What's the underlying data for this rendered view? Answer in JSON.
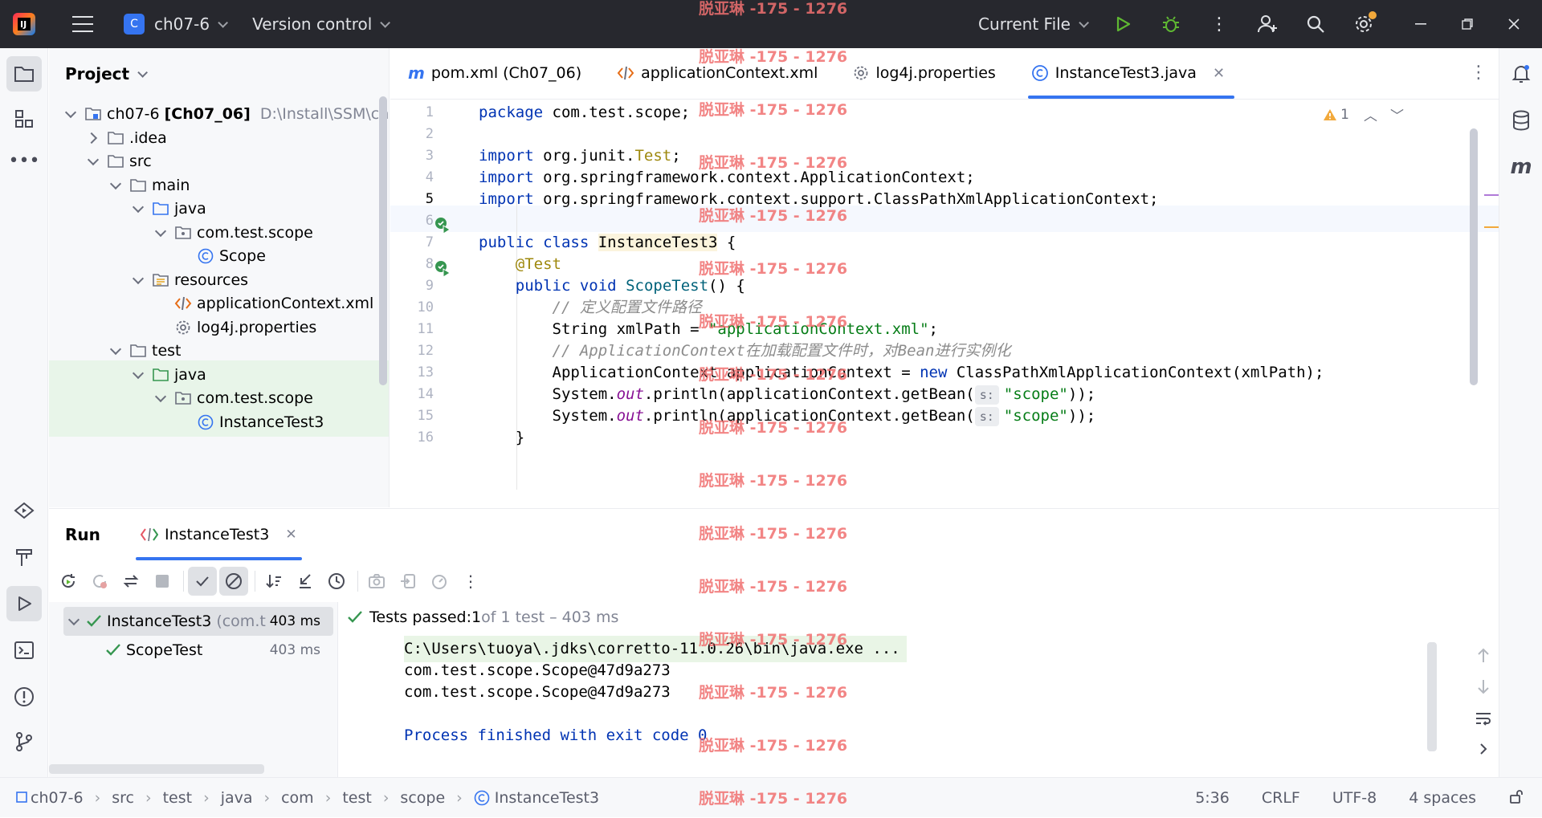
{
  "titlebar": {
    "project_badge": "C",
    "project_name": "ch07-6",
    "vcs": "Version control",
    "run_config": "Current File"
  },
  "project_panel": {
    "title": "Project",
    "tree": [
      {
        "label": "ch07-6",
        "module": "[Ch07_06]",
        "path": "D:\\Install\\SSM\\ch",
        "icon": "module-folder-icon"
      },
      {
        "label": ".idea",
        "icon": "folder-icon"
      },
      {
        "label": "src",
        "icon": "folder-icon"
      },
      {
        "label": "main",
        "icon": "folder-icon"
      },
      {
        "label": "java",
        "icon": "source-folder-icon"
      },
      {
        "label": "com.test.scope",
        "icon": "package-icon"
      },
      {
        "label": "Scope",
        "icon": "class-icon"
      },
      {
        "label": "resources",
        "icon": "resources-folder-icon"
      },
      {
        "label": "applicationContext.xml",
        "icon": "xml-file-icon"
      },
      {
        "label": "log4j.properties",
        "icon": "properties-file-icon"
      },
      {
        "label": "test",
        "icon": "folder-icon"
      },
      {
        "label": "java",
        "icon": "test-source-folder-icon"
      },
      {
        "label": "com.test.scope",
        "icon": "package-icon"
      },
      {
        "label": "InstanceTest3",
        "icon": "class-icon"
      }
    ]
  },
  "editor": {
    "tabs": [
      {
        "label": "pom.xml (Ch07_06)",
        "icon": "maven-icon"
      },
      {
        "label": "applicationContext.xml",
        "icon": "xml-file-icon"
      },
      {
        "label": "log4j.properties",
        "icon": "properties-file-icon"
      },
      {
        "label": "InstanceTest3.java",
        "icon": "class-icon",
        "active": true
      }
    ],
    "warnings": "1",
    "line_numbers": [
      "1",
      "2",
      "3",
      "4",
      "5",
      "6",
      "7",
      "8",
      "9",
      "10",
      "11",
      "12",
      "13",
      "14",
      "15",
      "16"
    ],
    "code": {
      "l1_kw": "package",
      "l1_rest": " com.test.scope;",
      "l3_kw": "import",
      "l3_a": " org.junit.",
      "l3_b": "Test",
      "l3_c": ";",
      "l4_kw": "import",
      "l4_rest": " org.springframework.context.ApplicationContext;",
      "l5_kw": "import",
      "l5_rest": " org.springframework.context.support.ClassPathXmlApplicationContext;",
      "l7_kw": "public class",
      "l7_cls": "InstanceTest3",
      "l7_rest": " {",
      "l8_ann": "@Test",
      "l9_kw": "public void",
      "l9_m": "ScopeTest",
      "l9_rest": "() {",
      "l10_cmt": "// 定义配置文件路径",
      "l11_a": "String xmlPath = ",
      "l11_str": "\"applicationContext.xml\"",
      "l11_b": ";",
      "l12_cmt": "// ApplicationContext在加载配置文件时，对Bean进行实例化",
      "l13_a": "ApplicationContext applicationContext = ",
      "l13_kw": "new",
      "l13_b": " ClassPathXmlApplicationContext(xmlPath);",
      "l14_a": "System.",
      "l14_fld": "out",
      "l14_b": ".println(applicationContext.getBean(",
      "l14_hint": "s:",
      "l14_str": "\"scope\"",
      "l14_c": "));",
      "l15_a": "System.",
      "l15_fld": "out",
      "l15_b": ".println(applicationContext.getBean(",
      "l15_hint": "s:",
      "l15_str": "\"scope\"",
      "l15_c": "));",
      "l16": "}"
    }
  },
  "run_panel": {
    "title": "Run",
    "tab_label": "InstanceTest3",
    "tests": [
      {
        "label": "InstanceTest3",
        "suffix": "(com.t",
        "time": "403 ms"
      },
      {
        "label": "ScopeTest",
        "time": "403 ms"
      }
    ],
    "status_prefix": "Tests passed: ",
    "status_count": "1",
    "status_rest": " of 1 test – 403 ms",
    "console": [
      "C:\\Users\\tuoya\\.jdks\\corretto-11.0.26\\bin\\java.exe ...",
      "com.test.scope.Scope@47d9a273",
      "com.test.scope.Scope@47d9a273",
      "",
      "Process finished with exit code 0"
    ]
  },
  "statusbar": {
    "breadcrumbs": [
      "ch07-6",
      "src",
      "test",
      "java",
      "com",
      "test",
      "scope",
      "InstanceTest3"
    ],
    "position": "5:36",
    "line_sep": "CRLF",
    "encoding": "UTF-8",
    "indent": "4 spaces"
  },
  "watermark": "脱亚琳 -175 - 1276",
  "colors": {
    "accent": "#3574f0",
    "pass": "#369650",
    "run": "#5fb832",
    "keyword": "#0033b3",
    "string": "#067d17"
  }
}
